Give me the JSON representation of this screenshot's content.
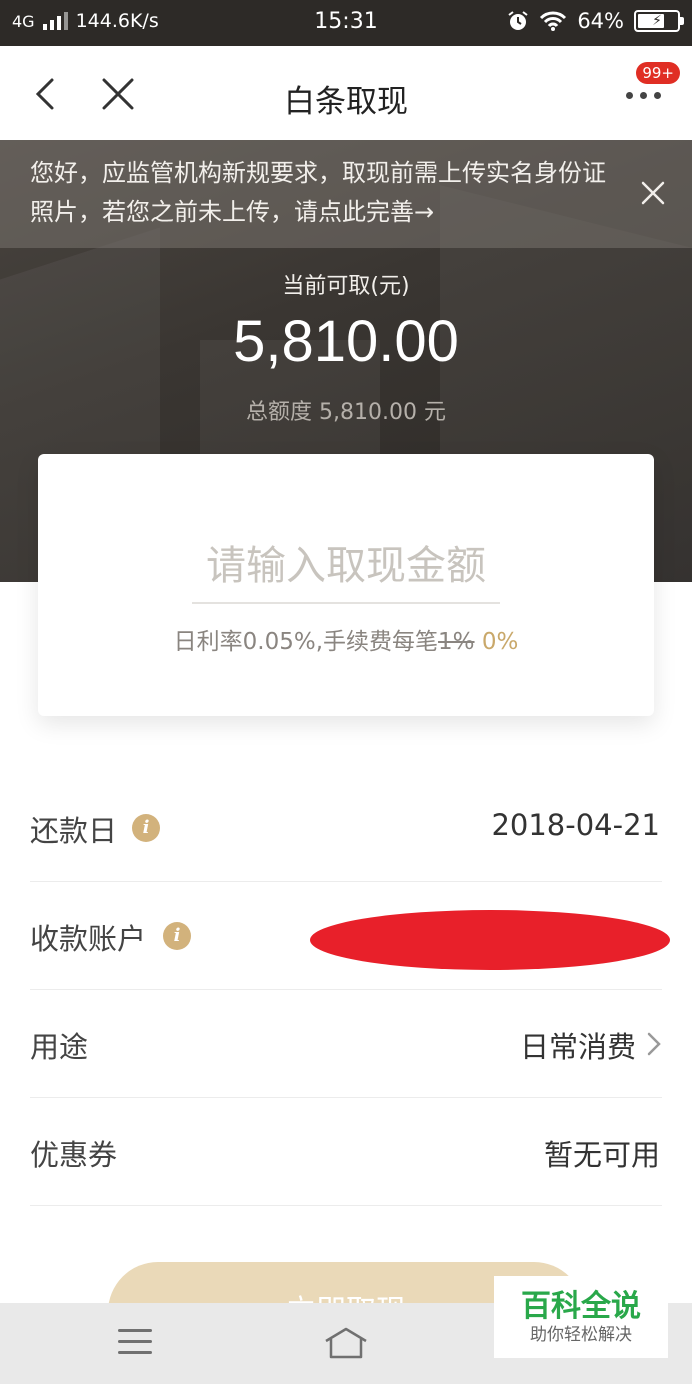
{
  "status_bar": {
    "network": "4G",
    "speed": "144.6K/s",
    "time": "15:31",
    "battery": "64%",
    "battery_level": 0.64
  },
  "nav": {
    "title": "白条取现",
    "badge": "99+",
    "back_icon": "chevron-left-icon",
    "close_icon": "close-icon",
    "more_icon": "more-dots-icon"
  },
  "notice": {
    "text": "您好，应监管机构新规要求，取现前需上传实名身份证照片，若您之前未上传，请点此完善→"
  },
  "balance": {
    "label": "当前可取(元)",
    "amount": "5,810.00",
    "total_line": "总额度 5,810.00 元"
  },
  "card": {
    "placeholder": "请输入取现金额",
    "rate_prefix": "日利率0.05%,手续费每笔",
    "fee_old": "1%",
    "fee_new": "0%"
  },
  "rows": [
    {
      "label": "还款日",
      "value": "2018-04-21"
    },
    {
      "label": "收款账户",
      "value": ""
    },
    {
      "label": "用途",
      "value": "日常消费"
    },
    {
      "label": "优惠券",
      "value": "暂无可用"
    }
  ],
  "submit": {
    "label": "立即取现"
  },
  "watermark": {
    "title": "百科全说",
    "subtitle": "助你轻松解决"
  },
  "colors": {
    "accent_gold": "#c9a86a",
    "info_icon": "#d2b27c",
    "redaction": "#e8202a",
    "hero_bg": "#3a3632"
  }
}
